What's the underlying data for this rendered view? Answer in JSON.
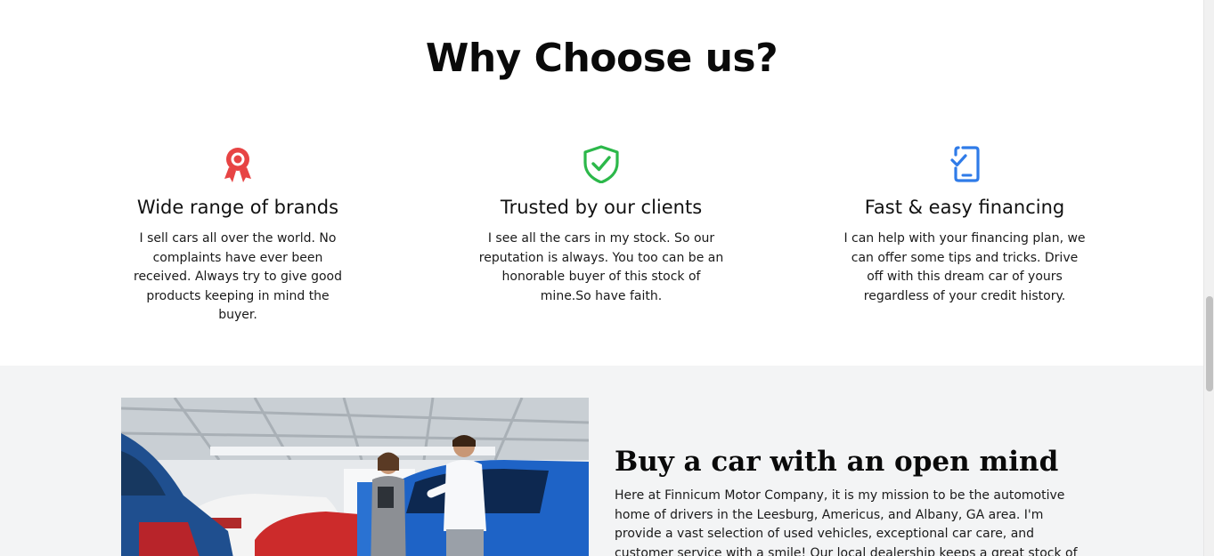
{
  "why_section": {
    "title": "Why Choose us?",
    "features": [
      {
        "icon": "award-ribbon-icon",
        "icon_color": "#e74444",
        "title": "Wide range of brands",
        "text": "I sell cars all over the world. No complaints have ever been received. Always try to give good products keeping in mind the buyer."
      },
      {
        "icon": "shield-check-icon",
        "icon_color": "#2cb84a",
        "title": "Trusted by our clients",
        "text": "I see all the cars in my stock. So our reputation is always. You too can be an honorable buyer of this stock of mine.So have faith."
      },
      {
        "icon": "phone-check-icon",
        "icon_color": "#2f7be8",
        "title": "Fast & easy financing",
        "text": "I can help with your financing plan, we can offer some tips and tricks. Drive off with this dream car of yours regardless of your credit history."
      }
    ]
  },
  "buy_section": {
    "image_alt": "dealership-photo",
    "title": "Buy a car with an open mind",
    "text": "Here at Finnicum Motor Company, it is my mission to be the automotive home of drivers in the Leesburg, Americus, and Albany, GA area. I'm provide a vast selection of used vehicles, exceptional car care, and customer service with a smile! Our local dealership keeps a great stock of used cars, trucks,"
  },
  "colors": {
    "section_gray": "#f3f4f5",
    "text": "#111111"
  }
}
